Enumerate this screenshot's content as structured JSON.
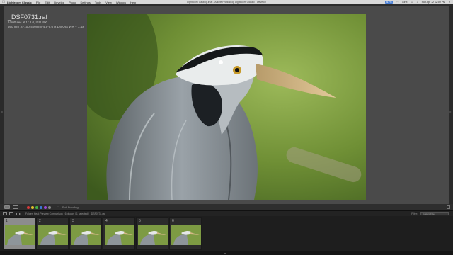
{
  "menubar": {
    "apple": "",
    "items": [
      "Lightroom Classic",
      "File",
      "Edit",
      "Develop",
      "Photo",
      "Settings",
      "Tools",
      "View",
      "Window",
      "Help"
    ],
    "window_title": "Lightroom Catalog.lrcat - Adobe Photoshop Lightroom Classic - Develop",
    "status": {
      "badge": "67%",
      "battery": "84%",
      "datetime": "Sun Apr 12  12:09 PM"
    }
  },
  "info_overlay": {
    "filename": "_DSF0731.raf",
    "exposure": "1/500 sec at f / 8.0, ISO 400",
    "lens": "560 mm  XF100-400mmF4.5-5.6 R LM OIS WR + 1.4x"
  },
  "toolbar": {
    "soft_proofing": "Soft Proofing",
    "flag_colors": [
      "#d63a3a",
      "#e0c02a",
      "#46b046",
      "#3a7ad6",
      "#9a4ad6",
      "#888888"
    ]
  },
  "filmstrip_header": {
    "source": "Folder: Heat Preview Comparison",
    "count": "6 photos / 1 selected / _DSF0731.raf",
    "filter_label": "Filter:",
    "filter_value": "Custom Filter"
  },
  "filmstrip": {
    "thumbnails": [
      {
        "number": "1",
        "selected": true
      },
      {
        "number": "2",
        "selected": false
      },
      {
        "number": "3",
        "selected": false
      },
      {
        "number": "4",
        "selected": false
      },
      {
        "number": "5",
        "selected": false
      },
      {
        "number": "6",
        "selected": false
      }
    ]
  }
}
